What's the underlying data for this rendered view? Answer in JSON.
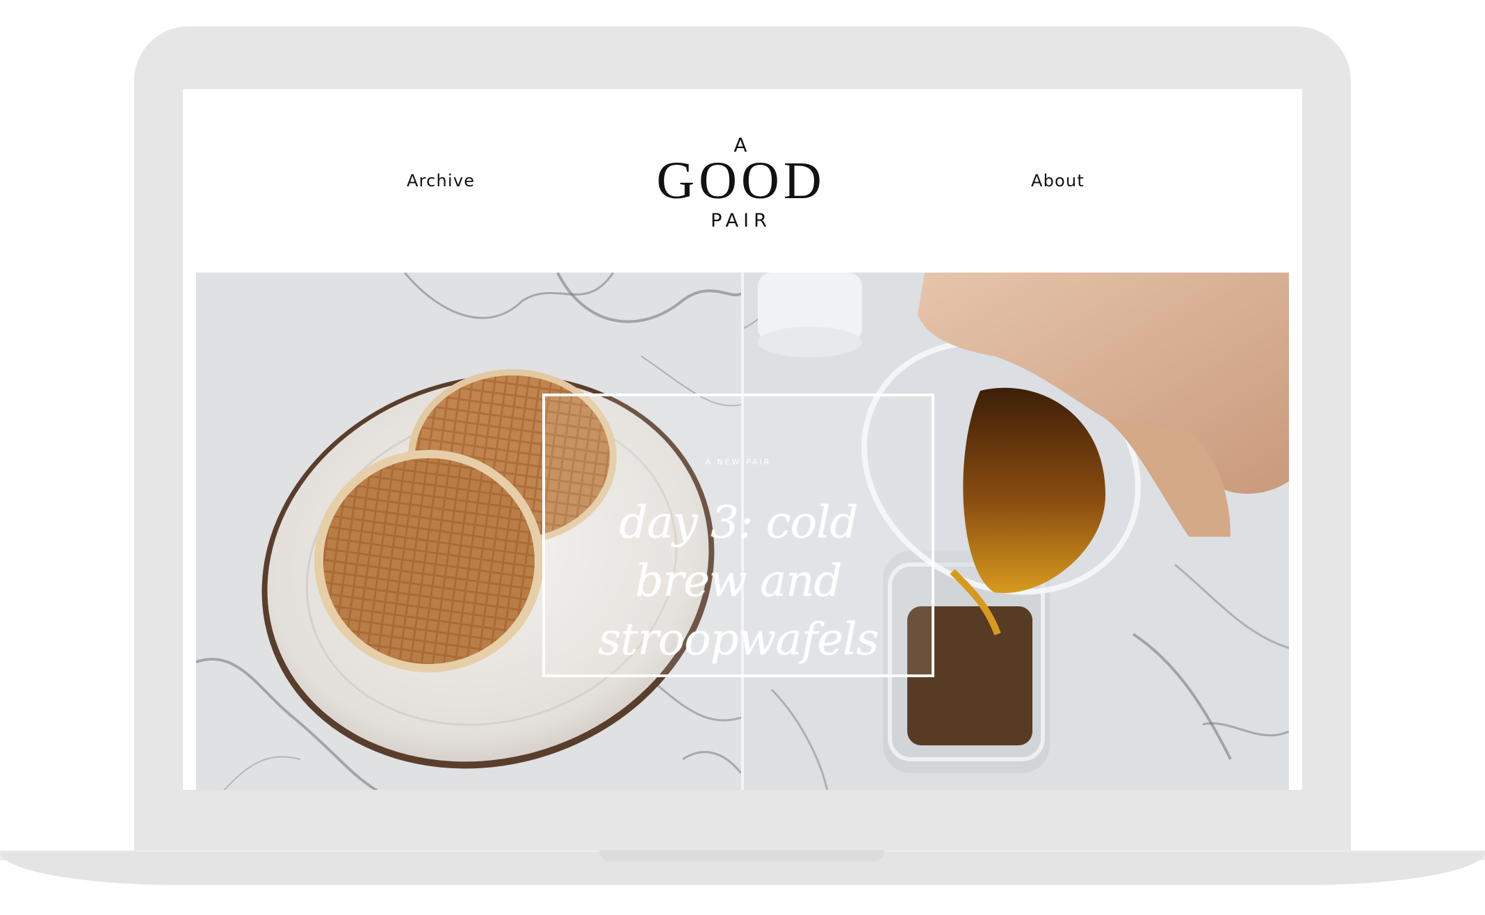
{
  "header": {
    "nav_left": "Archive",
    "nav_right": "About",
    "logo": {
      "top": "A",
      "main": "GOOD",
      "bottom": "PAIR"
    }
  },
  "hero": {
    "kicker": "A NEW PAIR",
    "title": "day 3: cold brew and stroopwafels"
  },
  "colors": {
    "text": "#111111",
    "frame": "#e6e6e6",
    "marble": "#dcdfe2",
    "waffle": "#b9773f",
    "coffee": "#6b3a10"
  }
}
